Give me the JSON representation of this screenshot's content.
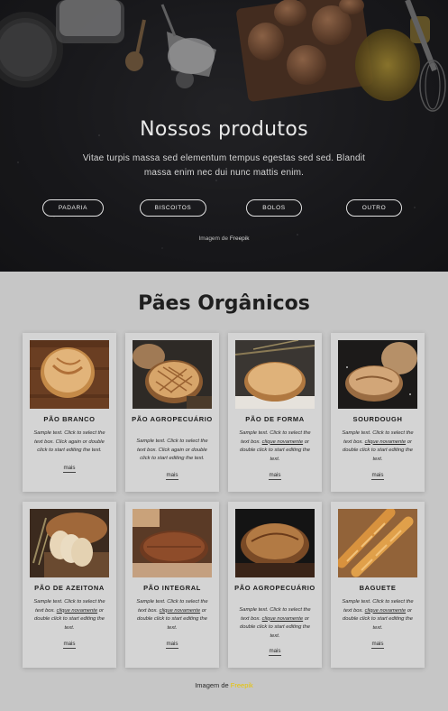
{
  "hero": {
    "title": "Nossos produtos",
    "text": "Vitae turpis massa sed elementum tempus egestas sed sed. Blandit massa enim nec dui nunc mattis enim.",
    "buttons": [
      "PADARIA",
      "BISCOITOS",
      "BOLOS",
      "OUTRO"
    ],
    "credit_prefix": "Imagem de ",
    "credit_link": "Freepik"
  },
  "section": {
    "title": "Pães Orgânicos",
    "more_label": "mais",
    "cards": [
      {
        "name": "PÃO BRANCO",
        "desc_a": "Sample text. Click to select the text box. Click again or double click to start editing the text.",
        "desc_link": "",
        "desc_b": ""
      },
      {
        "name": "PÃO AGROPECUÁRIO",
        "desc_a": "Sample text. Click to select the text box. Click again or double click to start editing the text.",
        "desc_link": "",
        "desc_b": ""
      },
      {
        "name": "PÃO DE FORMA",
        "desc_a": "Sample text. Click to select the text box. ",
        "desc_link": "clique novamente",
        "desc_b": " or double click to start editing the text."
      },
      {
        "name": "SOURDOUGH",
        "desc_a": "Sample text. Click to select the text box. ",
        "desc_link": "clique novamente",
        "desc_b": " or double click to start editing the text."
      },
      {
        "name": "PÃO DE AZEITONA",
        "desc_a": "Sample text. Click to select the text box. ",
        "desc_link": "clique novamente",
        "desc_b": " or double click to start editing the text."
      },
      {
        "name": "PÃO INTEGRAL",
        "desc_a": "Sample text. Click to select the text box. ",
        "desc_link": "clique novamente",
        "desc_b": " or double click to start editing the text."
      },
      {
        "name": "PÃO AGROPECUÁRIO",
        "desc_a": "Sample text. Click to select the text box. ",
        "desc_link": "clique novamente",
        "desc_b": " or double click to start editing the text."
      },
      {
        "name": "BAGUETE",
        "desc_a": "Sample text. Click to select the text box. ",
        "desc_link": "clique novamente",
        "desc_b": " or double click to start editing the text."
      }
    ]
  },
  "footer": {
    "credit_prefix": "Imagem de ",
    "credit_link": "Freepik"
  },
  "colors": {
    "hero_bg": "#1b1b1e",
    "section_bg": "#c6c6c6",
    "card_bg": "#d4d4d4",
    "footer_link": "#e8c400"
  },
  "icons": [
    "bread-photo",
    "flour-photo",
    "eggs-photo"
  ]
}
